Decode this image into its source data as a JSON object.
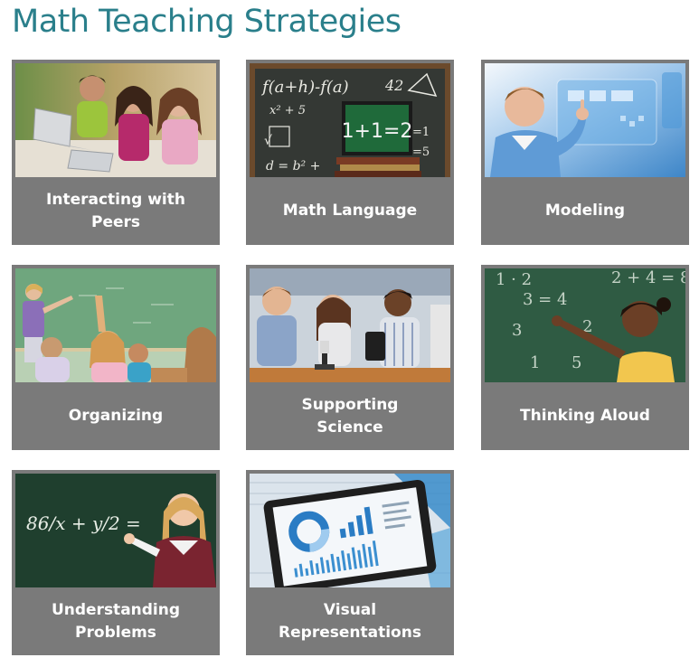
{
  "page": {
    "title": "Math Teaching Strategies",
    "title_color": "#2a7f8b",
    "card_bg": "#7a7a7a"
  },
  "cards": [
    {
      "label": "Interacting with Peers",
      "image": "students-with-laptops-photo"
    },
    {
      "label": "Math Language",
      "image": "chalkboard-formulas-photo",
      "board_text": "1+1=2",
      "board_formula": "f(a+h)-f(a)"
    },
    {
      "label": "Modeling",
      "image": "boy-touching-screen-photo"
    },
    {
      "label": "Organizing",
      "image": "classroom-teacher-photo"
    },
    {
      "label": "Supporting Science",
      "image": "students-microscope-photo"
    },
    {
      "label": "Thinking Aloud",
      "image": "girl-at-chalkboard-photo"
    },
    {
      "label": "Understanding Problems",
      "image": "girl-chalkboard-fraction-photo",
      "board_formula": "86/x + y/2 ="
    },
    {
      "label": "Visual Representations",
      "image": "tablet-charts-photo"
    }
  ]
}
